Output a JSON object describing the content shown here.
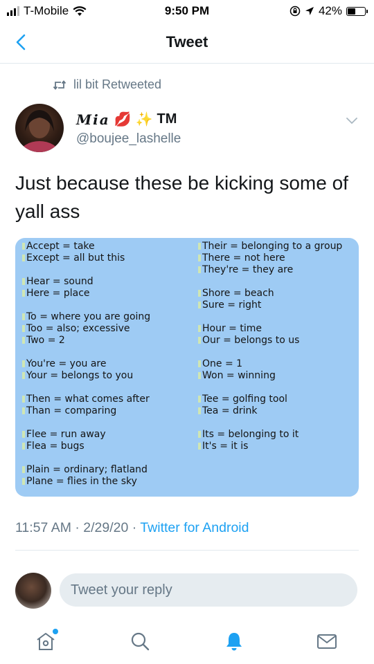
{
  "status_bar": {
    "carrier": "T-Mobile",
    "time": "9:50 PM",
    "battery_percent": "42%",
    "battery_level": 0.42
  },
  "nav": {
    "title": "Tweet",
    "back_icon": "chevron-left-icon"
  },
  "retweet": {
    "text": "lil bit Retweeted",
    "icon": "retweet-icon"
  },
  "author": {
    "display_name_script": "Mia",
    "display_name_suffix": "TM",
    "handle": "@boujee_lashelle",
    "emoji_lips": "💋",
    "emoji_sparkle": "✨"
  },
  "tweet": {
    "text": "Just because these be kicking some of yall ass",
    "timestamp": "11:57 AM · 2/29/20 · ",
    "source": "Twitter for Android"
  },
  "image": {
    "left_groups": [
      [
        "Accept = take",
        "Except = all but this"
      ],
      [
        "Hear = sound",
        "Here = place"
      ],
      [
        "To = where you are going",
        "Too = also; excessive",
        "Two = 2"
      ],
      [
        "You're = you are",
        "Your = belongs to you"
      ],
      [
        "Then = what comes after",
        "Than = comparing"
      ],
      [
        "Flee = run away",
        "Flea = bugs"
      ],
      [
        "Plain = ordinary; flatland",
        "Plane = flies in the sky"
      ]
    ],
    "right_groups": [
      [
        "Their = belonging to a group",
        "There = not here",
        "They're = they are"
      ],
      [
        "Shore = beach",
        "Sure = right"
      ],
      [
        "Hour = time",
        "Our = belongs to us"
      ],
      [
        "One = 1",
        "Won = winning"
      ],
      [
        "Tee = golfing tool",
        "Tea = drink"
      ],
      [
        "Its = belonging to it",
        "It's = it is"
      ]
    ]
  },
  "reply": {
    "placeholder": "Tweet your reply"
  },
  "tabs": [
    {
      "name": "home",
      "icon": "home-icon"
    },
    {
      "name": "search",
      "icon": "search-icon"
    },
    {
      "name": "notifications",
      "icon": "bell-icon"
    },
    {
      "name": "messages",
      "icon": "mail-icon"
    }
  ],
  "colors": {
    "accent": "#1da1f2",
    "secondary_text": "#657786",
    "image_bg": "#9ecbf4"
  }
}
